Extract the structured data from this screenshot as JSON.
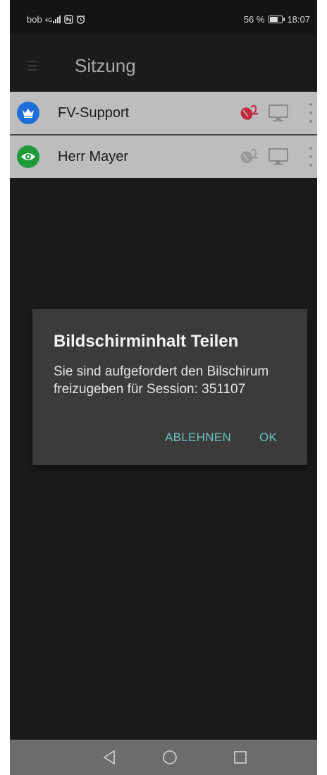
{
  "statusbar": {
    "carrier": "bob",
    "network": "4G",
    "battery_percent": "56 %",
    "battery_level": 0.56,
    "time": "18:07"
  },
  "toolbar": {
    "title": "Sitzung",
    "menu_icon": "menu-icon"
  },
  "participants": [
    {
      "name": "FV-Support",
      "role_icon": "crown-icon",
      "avatar_color": "#1e6fd9",
      "mouse_icon_color": "#c0293e"
    },
    {
      "name": "Herr Mayer",
      "role_icon": "eye-icon",
      "avatar_color": "#1e9a3a",
      "mouse_icon_color": "#9a9a9a"
    }
  ],
  "dialog": {
    "title": "Bildschirminhalt Teilen",
    "message": "Sie sind aufgefordert den Bilschirum freizugeben für Session: 351107",
    "decline_label": "ABLEHNEN",
    "ok_label": "OK",
    "accent_color": "#6ec3c0"
  },
  "navbar": {
    "back_icon": "back-icon",
    "home_icon": "home-icon",
    "recents_icon": "recents-icon"
  }
}
